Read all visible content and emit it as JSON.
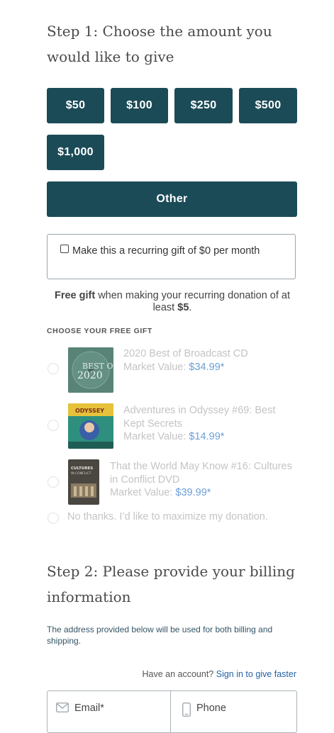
{
  "step1": {
    "title": "Step 1: Choose the amount you would like to give",
    "amounts": [
      "$50",
      "$100",
      "$250",
      "$500",
      "$1,000"
    ],
    "other_label": "Other",
    "recurring": {
      "label": "Make this a recurring gift of $0 per month",
      "checked": false
    },
    "free_gift_note": {
      "bold1": "Free gift",
      "text1": " when making your recurring donation of at least ",
      "bold2": "$5",
      "text2": "."
    },
    "choose_label": "CHOOSE YOUR FREE GIFT",
    "gifts": [
      {
        "title": "2020 Best of Broadcast CD",
        "market_label": "Market Value: ",
        "price": "$34.99*",
        "icon": "best-of-2020-cd-cover",
        "cover_text_1": "BEST OF",
        "cover_text_2": "2020"
      },
      {
        "title": "Adventures in Odyssey #69: Best Kept Secrets",
        "market_label": "Market Value: ",
        "price": "$14.99*",
        "icon": "odyssey-album-cover",
        "cover_text_1": "ODYSSEY"
      },
      {
        "title": "That the World May Know #16: Cultures in Conflict DVD",
        "market_label": "Market Value: ",
        "price": "$39.99*",
        "icon": "cultures-in-conflict-dvd-cover",
        "cover_text_1": "CULTURES",
        "cover_text_2": "IN CONFLICT"
      }
    ],
    "no_thanks": "No thanks. I’d like to maximize my donation."
  },
  "step2": {
    "title": "Step 2: Please provide your billing information",
    "billing_note": "The address provided below will be used for both billing and shipping.",
    "account_prompt": "Have an account? ",
    "sign_in_link": "Sign in to give faster",
    "email_placeholder": "Email*",
    "phone_placeholder": "Phone"
  },
  "colors": {
    "primary": "#1b4b57",
    "link": "#2563a6",
    "price": "#6b9fd6"
  }
}
